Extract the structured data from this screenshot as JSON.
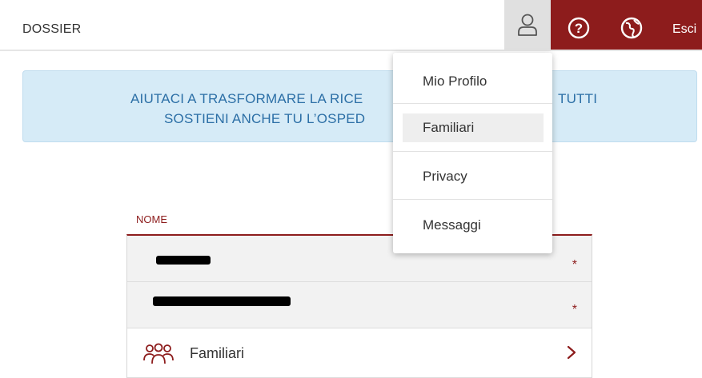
{
  "header": {
    "title": "DOSSIER",
    "logout_label": "Esci",
    "accent_color": "#8d1c1c",
    "icons": [
      "user-icon",
      "help-icon",
      "language-icon"
    ]
  },
  "banner": {
    "line1": "AIUTACI A TRASFORMARE LA RICE",
    "line1_tail": "TUTTI",
    "line2": "SOSTIENI ANCHE TU L’OSPED"
  },
  "user_menu": {
    "items": [
      {
        "label": "Mio Profilo"
      },
      {
        "label": "Familiari",
        "highlighted": true
      },
      {
        "label": "Privacy"
      },
      {
        "label": "Messaggi"
      }
    ]
  },
  "form": {
    "field_label": "NOME",
    "required_marker": "*",
    "family_row_label": "Familiari",
    "family_icon": "family-icon",
    "chevron_icon": "chevron-right-icon"
  }
}
